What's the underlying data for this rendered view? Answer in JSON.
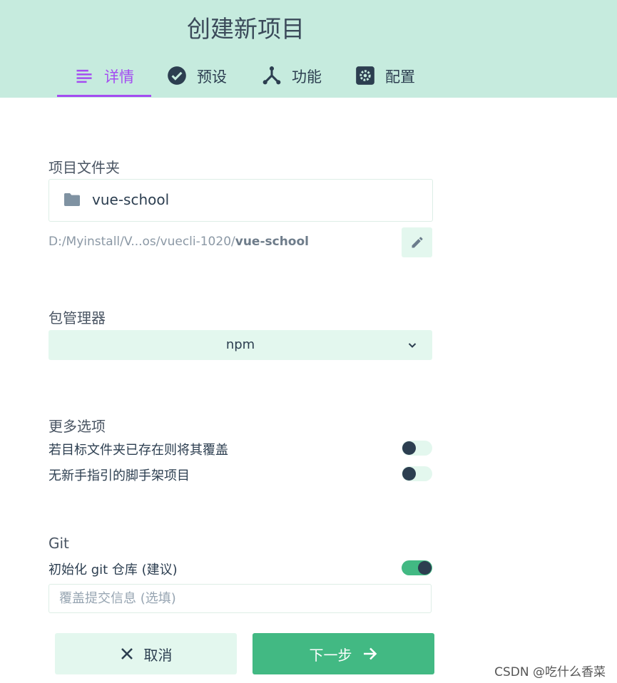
{
  "header": {
    "title": "创建新项目"
  },
  "tabs": [
    {
      "label": "详情",
      "icon": "details-list-icon",
      "active": true
    },
    {
      "label": "预设",
      "icon": "check-circle-icon",
      "active": false
    },
    {
      "label": "功能",
      "icon": "fork-icon",
      "active": false
    },
    {
      "label": "配置",
      "icon": "gear-icon",
      "active": false
    }
  ],
  "folder": {
    "section_label": "项目文件夹",
    "name": "vue-school",
    "path_prefix": "D:/Myinstall/V...os/vuecli-1020/",
    "path_bold": "vue-school"
  },
  "package_manager": {
    "section_label": "包管理器",
    "selected": "npm"
  },
  "more_options": {
    "section_label": "更多选项",
    "items": [
      {
        "label": "若目标文件夹已存在则将其覆盖",
        "on": false
      },
      {
        "label": "无新手指引的脚手架项目",
        "on": false
      }
    ]
  },
  "git": {
    "section_label": "Git",
    "init_label": "初始化 git 仓库 (建议)",
    "init_on": true,
    "commit_placeholder": "覆盖提交信息 (选填)",
    "commit_value": ""
  },
  "actions": {
    "cancel_label": "取消",
    "next_label": "下一步"
  },
  "watermark": "CSDN @吃什么香菜",
  "colors": {
    "accent": "#42b983",
    "header_bg": "#c6ebde",
    "active_tab": "#a44cf1",
    "light_bg": "#e3f7ee"
  }
}
